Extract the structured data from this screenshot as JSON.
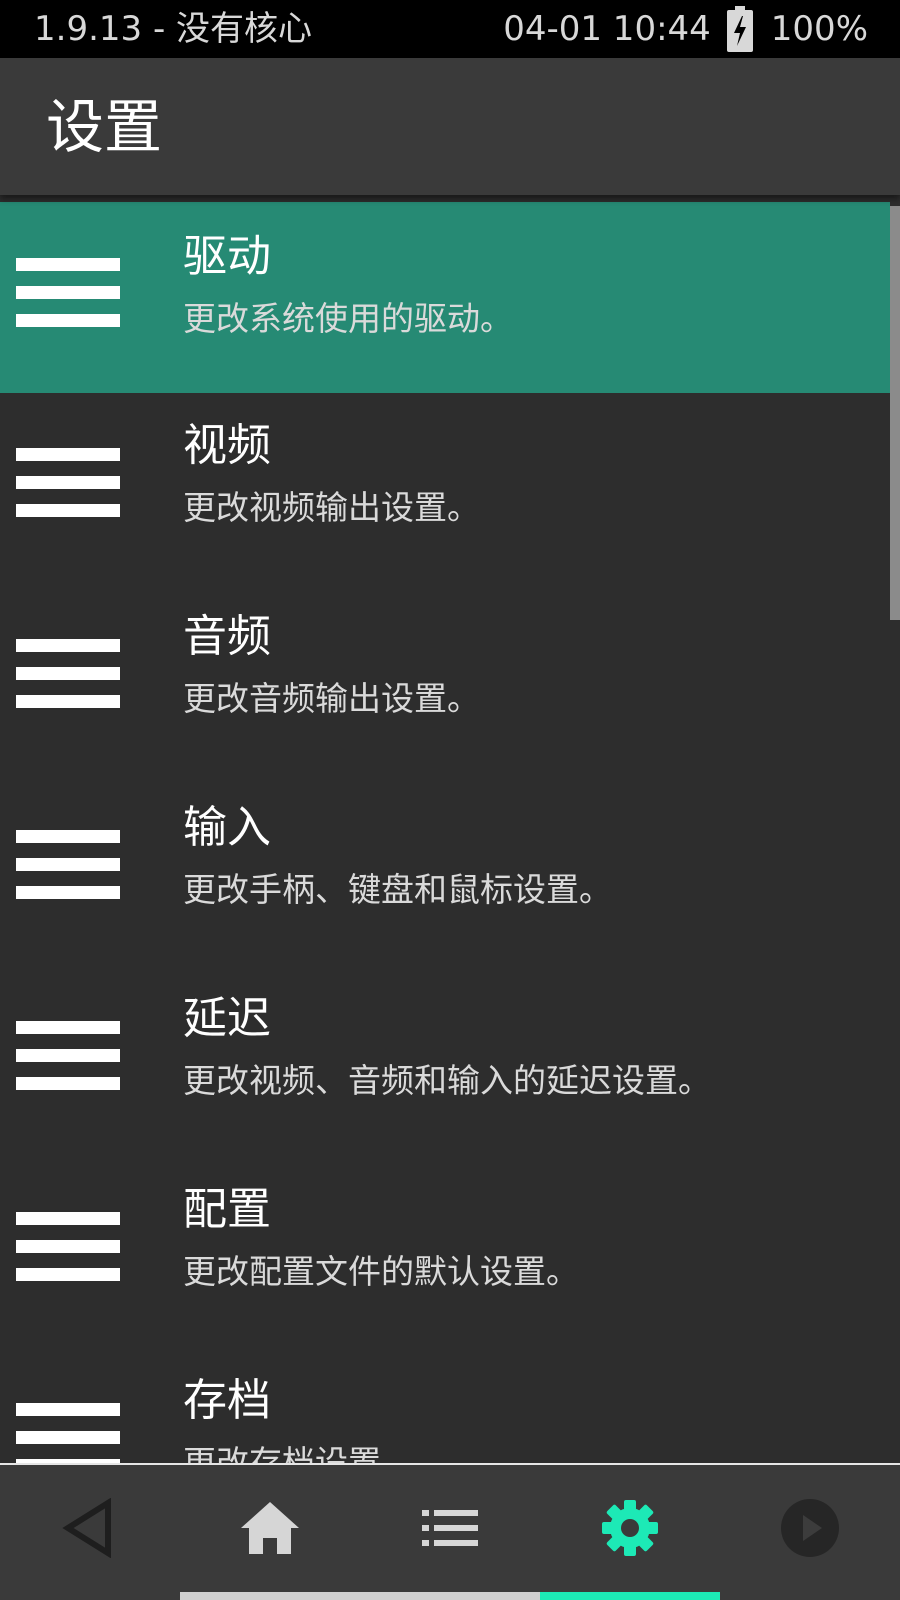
{
  "status_bar": {
    "left_text": "1.9.13 - 没有核心",
    "datetime": "04-01 10:44",
    "battery_percent": "100%",
    "battery_icon": "battery-charging-icon"
  },
  "app_bar": {
    "title": "设置"
  },
  "settings": [
    {
      "title": "驱动",
      "subtitle": "更改系统使用的驱动。",
      "icon": "menu-lines-icon",
      "selected": true
    },
    {
      "title": "视频",
      "subtitle": "更改视频输出设置。",
      "icon": "menu-lines-icon",
      "selected": false
    },
    {
      "title": "音频",
      "subtitle": "更改音频输出设置。",
      "icon": "menu-lines-icon",
      "selected": false
    },
    {
      "title": "输入",
      "subtitle": "更改手柄、键盘和鼠标设置。",
      "icon": "menu-lines-icon",
      "selected": false
    },
    {
      "title": "延迟",
      "subtitle": "更改视频、音频和输入的延迟设置。",
      "icon": "menu-lines-icon",
      "selected": false
    },
    {
      "title": "配置",
      "subtitle": "更改配置文件的默认设置。",
      "icon": "menu-lines-icon",
      "selected": false
    },
    {
      "title": "存档",
      "subtitle": "更改存档设置。",
      "icon": "menu-lines-icon",
      "selected": false
    }
  ],
  "bottom_nav": {
    "items": [
      {
        "icon": "back-triangle-icon",
        "active": false
      },
      {
        "icon": "home-icon",
        "active": false
      },
      {
        "icon": "playlist-icon",
        "active": false
      },
      {
        "icon": "settings-gear-icon",
        "active": true
      },
      {
        "icon": "play-circle-icon",
        "active": false
      }
    ],
    "active_index": 3
  },
  "colors": {
    "selected_row": "#268a74",
    "accent": "#1de9b6",
    "background": "#2d2d2d",
    "header": "#3a3a3a",
    "status_bar": "#000000"
  }
}
